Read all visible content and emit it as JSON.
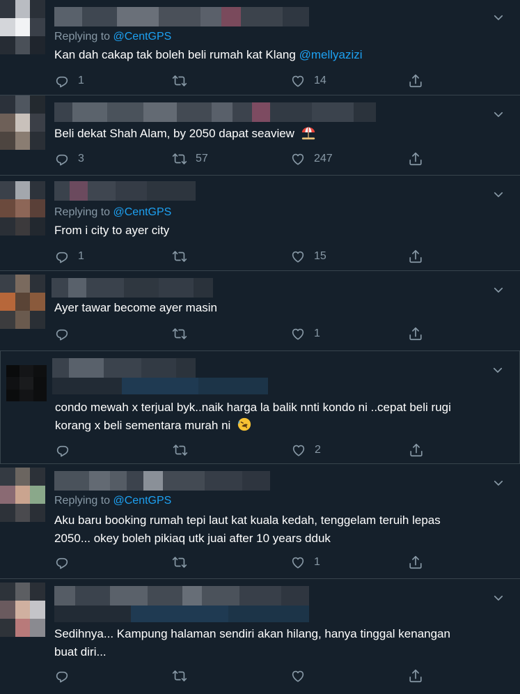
{
  "tweets": [
    {
      "replying_prefix": "Replying to",
      "replying_handle": "@CentGPS",
      "text": "Kan dah cakap tak boleh beli rumah kat Klang",
      "mention": "@mellyazizi",
      "replies": "1",
      "retweets": "",
      "likes": "14"
    },
    {
      "text": "Beli dekat Shah Alam, by 2050 dapat seaview",
      "emoji": "beach-umbrella",
      "replies": "3",
      "retweets": "57",
      "likes": "247"
    },
    {
      "replying_prefix": "Replying to",
      "replying_handle": "@CentGPS",
      "text": "From i city to ayer city",
      "replies": "1",
      "retweets": "",
      "likes": "15"
    },
    {
      "text": "Ayer tawar become ayer masin",
      "replies": "",
      "retweets": "",
      "likes": "1"
    },
    {
      "text_line1": "condo mewah x terjual byk..naik harga la balik nnti kondo ni ..cepat beli rugi",
      "text_line2": "korang x beli sementara murah ni",
      "emoji": "rolling-laughing",
      "replies": "",
      "retweets": "",
      "likes": "2"
    },
    {
      "replying_prefix": "Replying to",
      "replying_handle": "@CentGPS",
      "text_line1": "Aku baru booking rumah tepi laut kat kuala kedah, tenggelam teruih lepas",
      "text_line2": "2050... okey boleh pikiaq utk juai after 10 years dduk",
      "replies": "",
      "retweets": "",
      "likes": "1"
    },
    {
      "text_line1": "Sedihnya... Kampung halaman sendiri akan hilang, hanya tinggal kenangan",
      "text_line2": "buat diri...",
      "replies": "",
      "retweets": "",
      "likes": ""
    }
  ],
  "colors": {
    "background": "#15202b",
    "border": "#38444d",
    "muted": "#8899a6",
    "link": "#1da1f2",
    "text": "#ffffff"
  }
}
